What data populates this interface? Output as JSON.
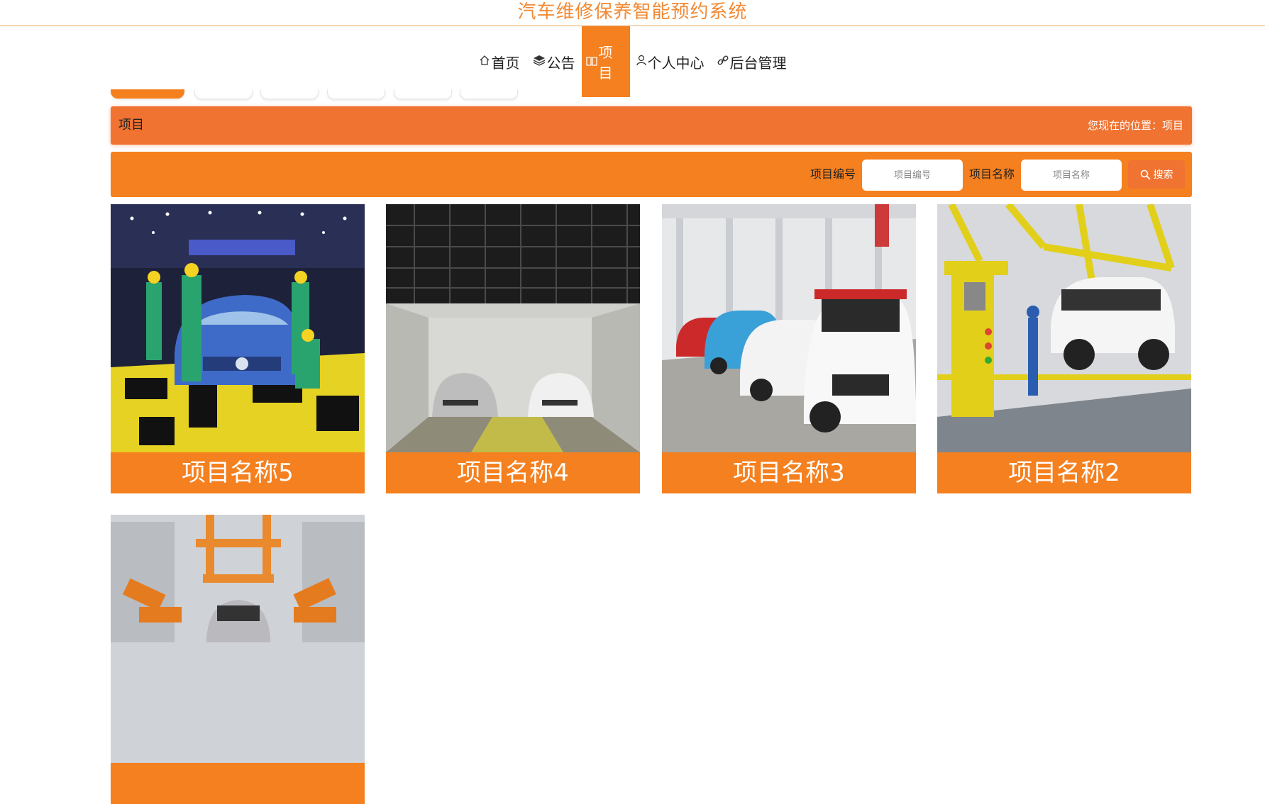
{
  "site": {
    "title": "汽车维修保养智能预约系统"
  },
  "nav": {
    "items": [
      {
        "icon": "home-icon",
        "label": "首页"
      },
      {
        "icon": "layers-icon",
        "label": "公告"
      },
      {
        "icon": "book-icon",
        "label": "项目"
      },
      {
        "icon": "user-icon",
        "label": "个人中心"
      },
      {
        "icon": "link-icon",
        "label": "后台管理"
      }
    ],
    "active": "项目"
  },
  "breadcrumb": {
    "title": "项目",
    "location_prefix": "您现在的位置：",
    "location": "项目"
  },
  "search": {
    "field1_label": "项目编号",
    "field1_placeholder": "项目编号",
    "field2_label": "项目名称",
    "field2_placeholder": "项目名称",
    "button_label": "搜索",
    "button_icon": "search-icon"
  },
  "projects": [
    {
      "name": "项目名称5"
    },
    {
      "name": "项目名称4"
    },
    {
      "name": "项目名称3"
    },
    {
      "name": "项目名称2"
    },
    {
      "name": ""
    }
  ],
  "colors": {
    "accent": "#f5801f",
    "breadcrumb_bg": "#f07332",
    "title": "#f28a35"
  }
}
